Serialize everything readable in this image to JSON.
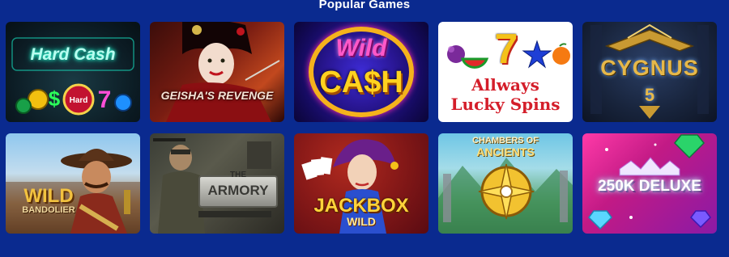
{
  "section": {
    "title": "Popular Games"
  },
  "games": [
    {
      "title": "Hard Cash"
    },
    {
      "title": "GEISHA'S REVENGE"
    },
    {
      "title_line1": "Wild",
      "title_line2": "CA$H"
    },
    {
      "title_line1": "Allways",
      "title_line2": "Lucky Spins",
      "symbol": "7"
    },
    {
      "title_line1": "CYGNUS",
      "title_line2": "5"
    },
    {
      "title_line1": "WILD",
      "title_line2": "BANDOLIER"
    },
    {
      "title_line1": "THE",
      "title_line2": "ARMORY"
    },
    {
      "title_line1": "JACKBOX",
      "title_line2": "WILD"
    },
    {
      "title_line1": "CHAMBERS OF",
      "title_line2": "ANCIENTS"
    },
    {
      "title": "250K DELUXE"
    }
  ],
  "colors": {
    "page_background": "#0a2a8f",
    "section_title": "#ffffff"
  }
}
